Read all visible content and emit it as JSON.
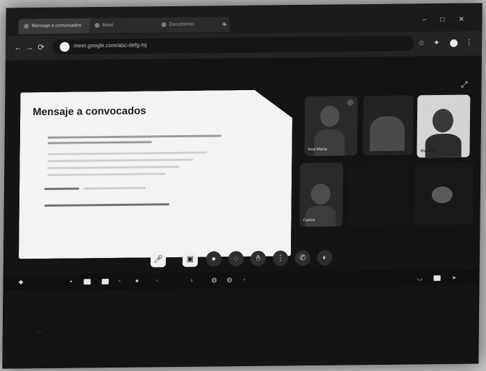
{
  "browser": {
    "tabs": [
      {
        "label": "Mensaje a convocados",
        "active": true
      },
      {
        "label": "Meet",
        "active": false
      },
      {
        "label": "Documento",
        "active": false
      }
    ],
    "new_tab": "+",
    "window_controls": [
      "–",
      "□",
      "✕"
    ],
    "url": "meet.google.com/abc-defg-hij",
    "nav": {
      "back": "←",
      "forward": "→",
      "reload": "⟳"
    },
    "toolbar_icons": [
      "star-icon",
      "extension-icon",
      "profile-icon",
      "menu-icon"
    ]
  },
  "meet": {
    "top_label": "",
    "panel": {
      "title": "Mensaje a convocados"
    },
    "participants": [
      {
        "name": "Ana María"
      },
      {
        "name": ""
      },
      {
        "name": "Mauricio"
      },
      {
        "name": "Carlos"
      },
      {
        "name": ""
      },
      {
        "name": ""
      }
    ],
    "controls": {
      "mic_icon": "mic-icon",
      "present_icon": "present-icon"
    }
  },
  "colors": {
    "panel_bg": "#f3f3f3",
    "meet_bg": "#141414",
    "title": "#1d1d1d"
  }
}
